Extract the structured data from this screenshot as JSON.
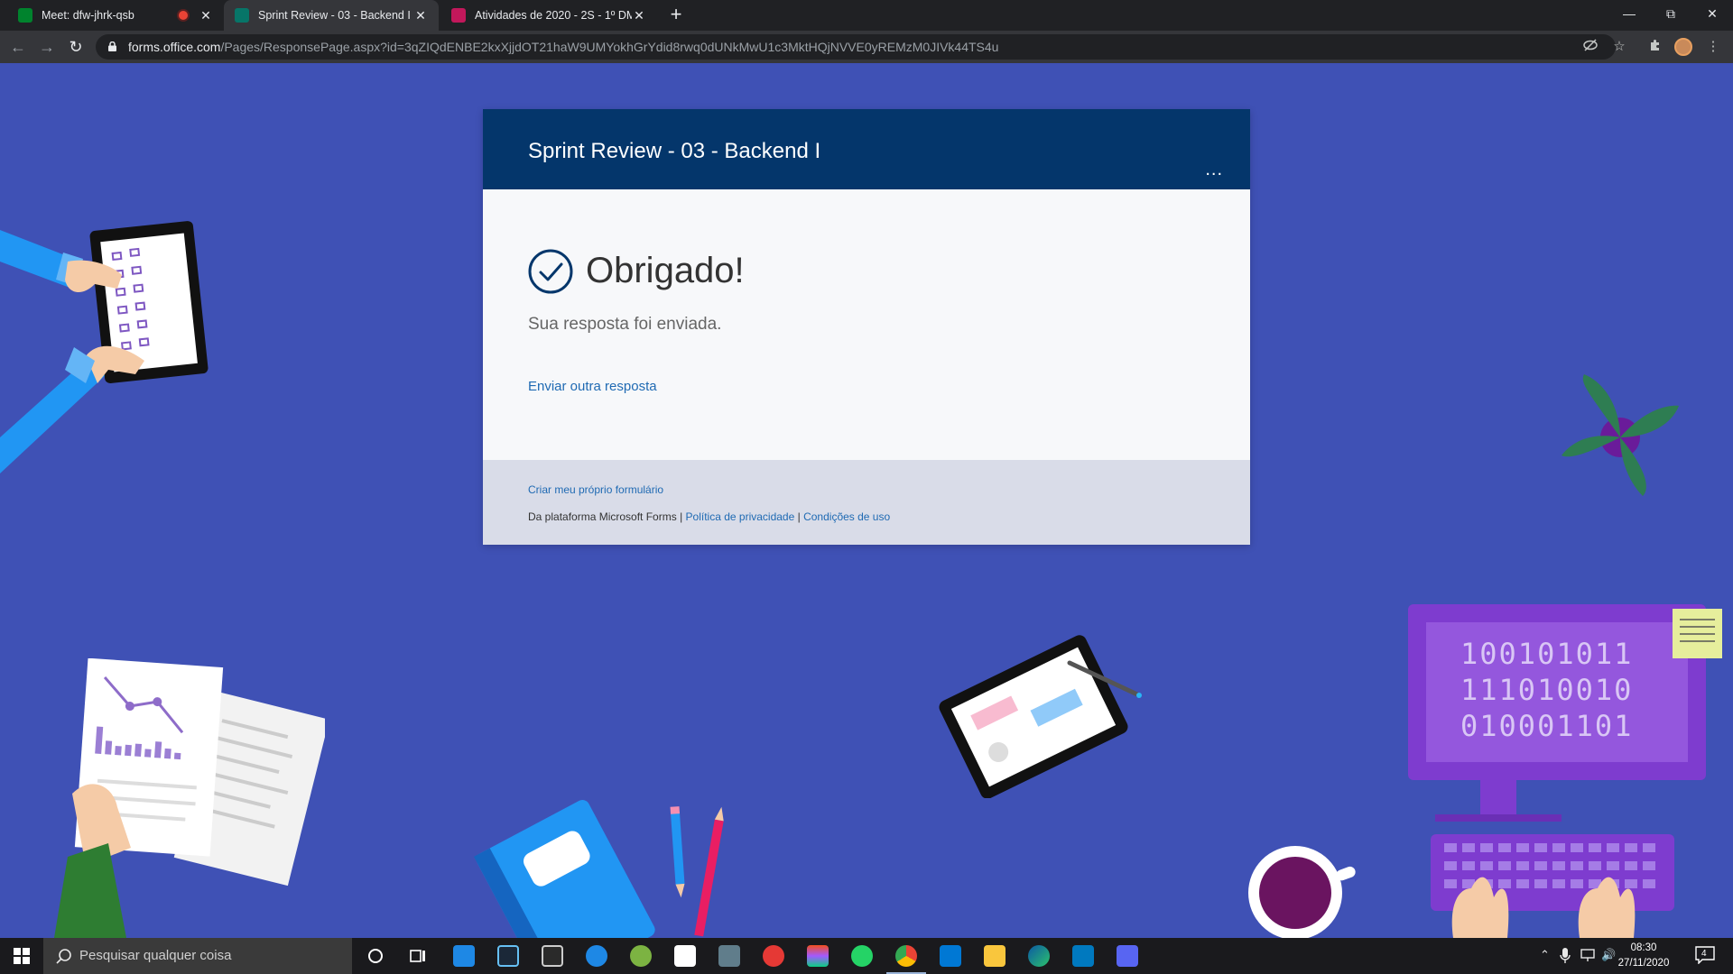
{
  "browser": {
    "tabs": [
      {
        "title": "Meet: dfw-jhrk-qsb",
        "favicon_color": "#00832d",
        "recording": true,
        "active": false
      },
      {
        "title": "Sprint Review - 03 - Backend I",
        "favicon_color": "#077568",
        "recording": false,
        "active": true
      },
      {
        "title": "Atividades de 2020 - 2S - 1º DM",
        "favicon_color": "#c2185b",
        "recording": false,
        "active": false
      }
    ],
    "address_domain": "forms.office.com",
    "address_path": "/Pages/ResponsePage.aspx?id=3qZIQdENBE2kxXjjdOT21haW9UMYokhGrYdid8rwq0dUNkMwU1c3MktHQjNVVE0yREMzM0JIVk44TS4u"
  },
  "form": {
    "title": "Sprint Review - 03 - Backend I",
    "more_label": "...",
    "thanks": "Obrigado!",
    "sent_message": "Sua resposta foi enviada.",
    "another_response": "Enviar outra resposta",
    "create_own": "Criar meu próprio formulário",
    "platform_text": "Da plataforma Microsoft Forms",
    "separator": "|",
    "privacy": "Política de privacidade",
    "terms": "Condições de uso"
  },
  "illustration": {
    "binary_lines": [
      "100101011",
      "111010010",
      "010001101"
    ]
  },
  "taskbar": {
    "search_placeholder": "Pesquisar qualquer coisa",
    "time": "08:30",
    "date": "27/11/2020",
    "notification_count": "4"
  },
  "colors": {
    "background": "#3f51b5",
    "form_header": "#04366b",
    "link": "#1f6ab3"
  }
}
